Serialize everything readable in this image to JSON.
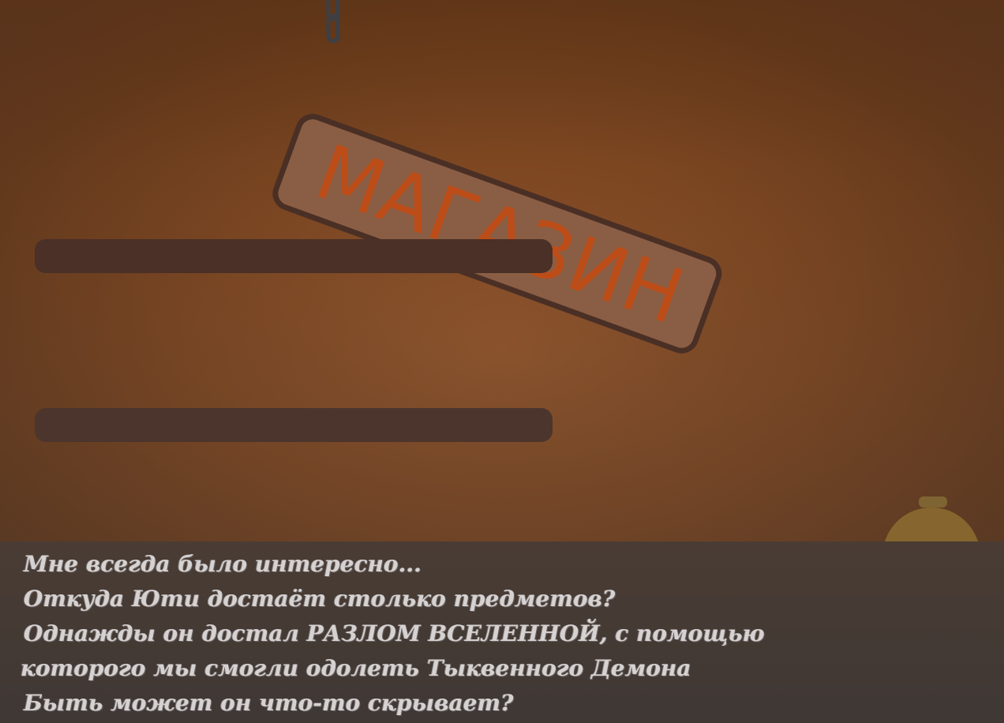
{
  "sign": {
    "title": "МАГАЗИН",
    "border_color": "#4a2f25",
    "fill_color": "#8a5e44",
    "text_color": "#bd4d18"
  },
  "shelves": [
    {
      "label": "top-shelf"
    },
    {
      "label": "bottom-shelf"
    }
  ],
  "bell": {
    "icon": "service-bell-icon",
    "color": "#8a6a2f"
  },
  "dialog": {
    "lines": [
      "Мне всегда было интересно...",
      "Откуда Юти достаёт столько предметов?",
      "Однажды он достал РАЗЛОМ ВСЕЛЕННОЙ, с помощью",
      "которого мы смогли одолеть Тыквенного Демона",
      "Быть может он что-то скрывает?"
    ]
  },
  "colors": {
    "background": "#7c4621",
    "shelf": "#4a3026",
    "dialog_box": "#423a36",
    "dialog_text": "#d7d2d2"
  }
}
